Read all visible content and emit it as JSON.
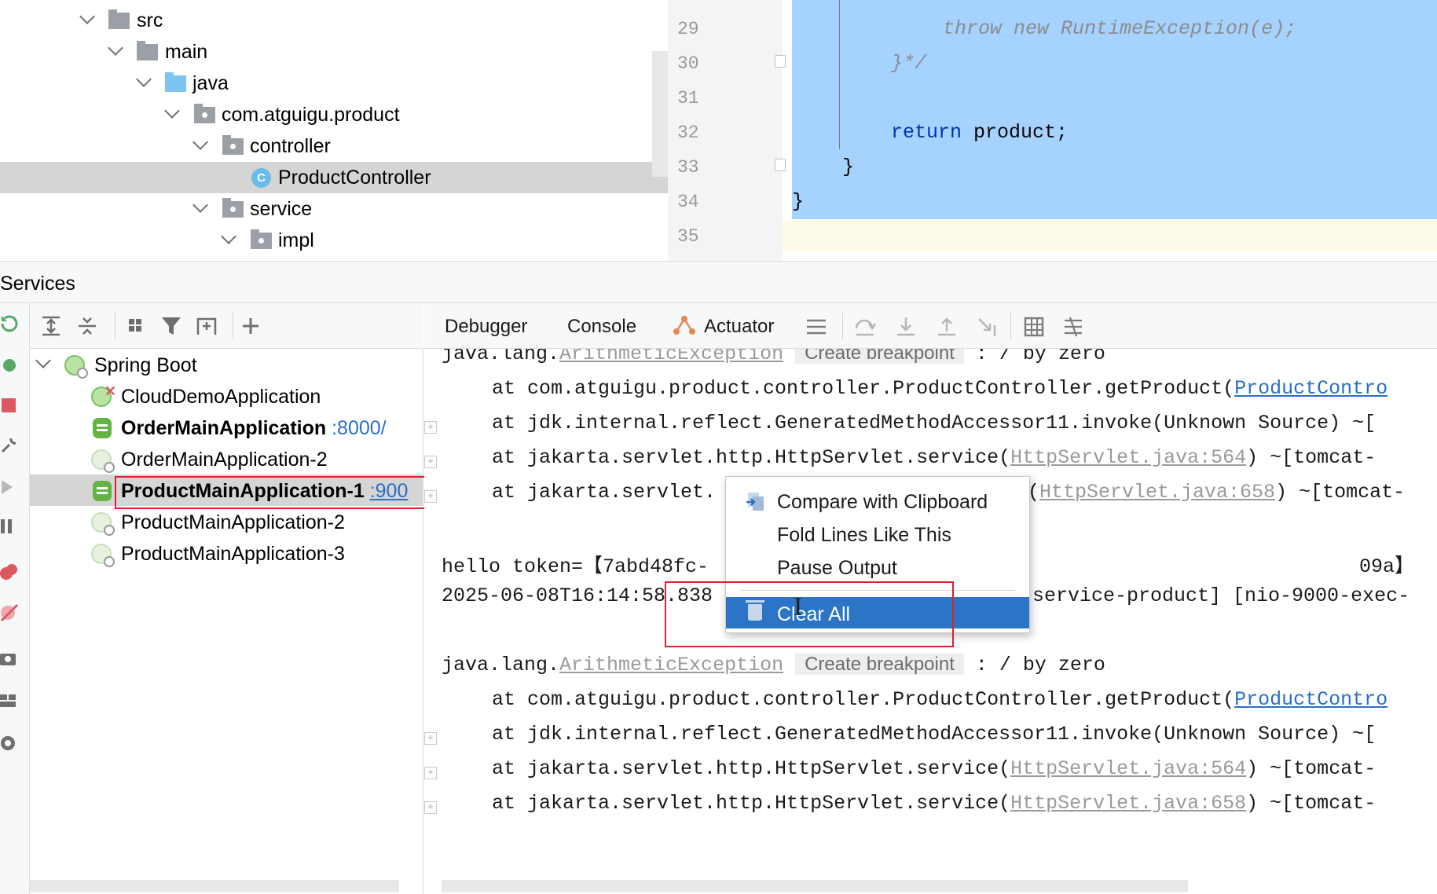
{
  "project_tree": {
    "items": [
      {
        "label": "src"
      },
      {
        "label": "main"
      },
      {
        "label": "java"
      },
      {
        "label": "com.atguigu.product"
      },
      {
        "label": "controller"
      },
      {
        "label": "ProductController",
        "icon_letter": "C"
      },
      {
        "label": "service"
      },
      {
        "label": "impl"
      }
    ]
  },
  "editor": {
    "line_numbers": [
      "29",
      "30",
      "31",
      "32",
      "33",
      "34",
      "35"
    ],
    "code": {
      "l29": "throw new RuntimeException(e);",
      "l30": "}*/",
      "l32_kw": "return",
      "l32_rest": " product;",
      "l33": "}",
      "l34": "}"
    }
  },
  "services": {
    "title": "Services",
    "root": "Spring Boot",
    "apps": [
      {
        "name": "CloudDemoApplication",
        "port": "",
        "status": "error"
      },
      {
        "name": "OrderMainApplication",
        "port": ":8000/",
        "status": "debug"
      },
      {
        "name": "OrderMainApplication-2",
        "port": "",
        "status": "stopped"
      },
      {
        "name": "ProductMainApplication-1",
        "port": ":900",
        "status": "debug"
      },
      {
        "name": "ProductMainApplication-2",
        "port": "",
        "status": "stopped"
      },
      {
        "name": "ProductMainApplication-3",
        "port": "",
        "status": "stopped"
      }
    ]
  },
  "console": {
    "tabs": {
      "debugger": "Debugger",
      "console": "Console",
      "actuator": "Actuator"
    },
    "block1": {
      "exc_prefix": "java.lang.",
      "exc_name": "ArithmeticException",
      "create_bp": "Create breakpoint",
      "exc_msg": " : / by zero",
      "trace1_pre": "at com.atguigu.product.controller.ProductController.getProduct(",
      "trace1_link": "ProductContro",
      "trace2": "at jdk.internal.reflect.GeneratedMethodAccessor11.invoke(Unknown Source) ~[",
      "trace3_pre": "at jakarta.servlet.http.HttpServlet.service(",
      "trace3_link": "HttpServlet.java:564",
      "trace3_post": ") ~[tomcat-",
      "trace4_pre": "at jakarta.servlet.",
      "trace4_mid": "(",
      "trace4_link": "HttpServlet.java:658",
      "trace4_post": ") ~[tomcat-"
    },
    "hello_pre": "hello token=【7abd48fc-",
    "hello_post": "09a】",
    "log_pre": "2025-06-08T16:14:58.838",
    "log_post": "service-product] [nio-9000-exec-",
    "block2": {
      "exc_prefix": "java.lang.",
      "exc_name": "ArithmeticException",
      "create_bp": "Create breakpoint",
      "exc_msg": " : / by zero",
      "trace1_pre": "at com.atguigu.product.controller.ProductController.getProduct(",
      "trace1_link": "ProductContro",
      "trace2": "at jdk.internal.reflect.GeneratedMethodAccessor11.invoke(Unknown Source) ~[",
      "trace3_pre": "at jakarta.servlet.http.HttpServlet.service(",
      "trace3_link": "HttpServlet.java:564",
      "trace3_post": ") ~[tomcat-",
      "trace4_pre": "at jakarta.servlet.http.HttpServlet.service(",
      "trace4_link": "HttpServlet.java:658",
      "trace4_post": ") ~[tomcat-"
    }
  },
  "context_menu": {
    "compare": "Compare with Clipboard",
    "fold": "Fold Lines Like This",
    "pause": "Pause Output",
    "clear": "Clear All"
  },
  "colors": {
    "selection": "#a6d2ff",
    "menu_active": "#2c75c6",
    "highlight_box": "#e0202a",
    "link": "#2a6fc7"
  }
}
